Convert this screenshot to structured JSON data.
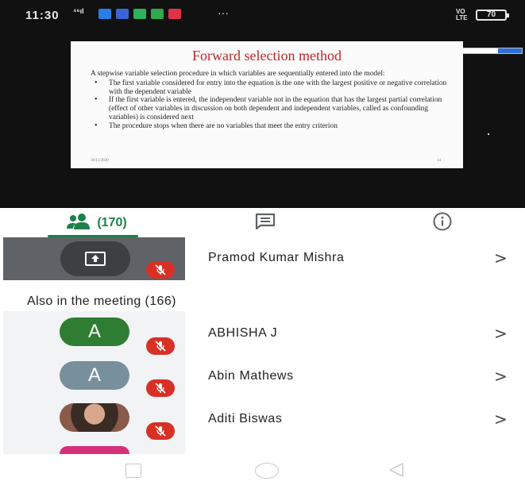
{
  "status_bar": {
    "time": "11:30",
    "signal_text": "⁴⁶ıl",
    "overflow": "···",
    "lte_line1": "VO",
    "lte_line2": "LTE",
    "battery": "70",
    "app_icon_colors": [
      "#2b7de9",
      "#3d63d8",
      "#2fb05c",
      "#2fa84f",
      "#e0334a"
    ]
  },
  "slide": {
    "title": "Forward selection method",
    "intro": "A stepwise variable selection procedure in which variables are sequentially entered into the model:",
    "bullets": [
      "The first variable considered for entry into the equation is the one with the largest positive or negative correlation with the dependent variable",
      "If the first variable is entered, the independent variable not in the equation that has the largest partial correlation (effect of other variables in discussion on both dependent and independent variables, called as confounding variables) is considered next",
      "The procedure stops when there are no variables that meet the entry criterion"
    ],
    "footer_date": "30/11/2020",
    "page_number": "14"
  },
  "tabs": {
    "people_count": "(170)",
    "people_icon": "people-icon",
    "chat_icon": "chat-icon",
    "info_icon": "info-icon",
    "accent_color": "#1e7f4a"
  },
  "presenter": {
    "name": "Pramod Kumar Mishra",
    "icon": "present-screen-icon"
  },
  "section_title": "Also in the meeting (166)",
  "participants": [
    {
      "initial": "A",
      "name": "ABHISHA J",
      "avatar_color": "#2e7d32"
    },
    {
      "initial": "A",
      "name": "Abin Mathews",
      "avatar_color": "#78909c"
    },
    {
      "initial": "",
      "name": "Aditi Biswas",
      "avatar_color": "#6d4c41"
    }
  ],
  "mute_color": "#d93025"
}
